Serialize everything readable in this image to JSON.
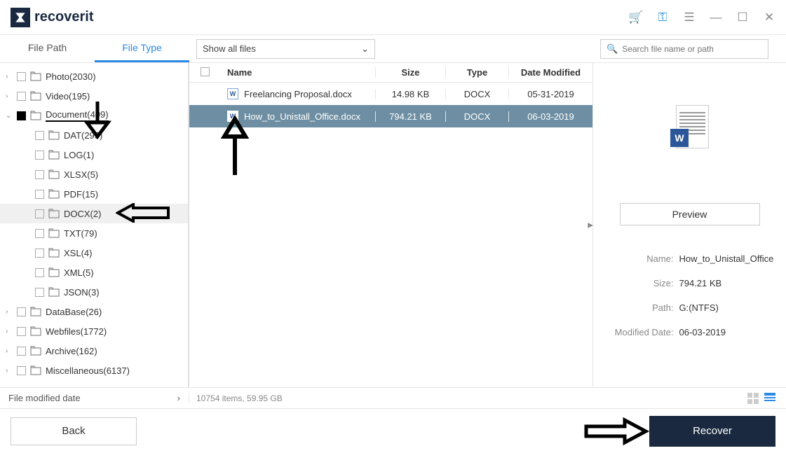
{
  "app": {
    "name": "recoverit"
  },
  "tabs": {
    "file_path": "File Path",
    "file_type": "File Type"
  },
  "filter": {
    "label": "Show all files"
  },
  "search": {
    "placeholder": "Search file name or path"
  },
  "tree": [
    {
      "label": "Photo(2030)",
      "caret": "›",
      "child": false
    },
    {
      "label": "Video(195)",
      "caret": "›",
      "child": false
    },
    {
      "label": "Document(409)",
      "caret": "⌄",
      "child": false,
      "filled": true,
      "underlined": true
    },
    {
      "label": "DAT(295)",
      "child": true
    },
    {
      "label": "LOG(1)",
      "child": true
    },
    {
      "label": "XLSX(5)",
      "child": true
    },
    {
      "label": "PDF(15)",
      "child": true
    },
    {
      "label": "DOCX(2)",
      "child": true,
      "selected": true
    },
    {
      "label": "TXT(79)",
      "child": true
    },
    {
      "label": "XSL(4)",
      "child": true
    },
    {
      "label": "XML(5)",
      "child": true
    },
    {
      "label": "JSON(3)",
      "child": true
    },
    {
      "label": "DataBase(26)",
      "caret": "›",
      "child": false
    },
    {
      "label": "Webfiles(1772)",
      "caret": "›",
      "child": false
    },
    {
      "label": "Archive(162)",
      "caret": "›",
      "child": false
    },
    {
      "label": "Miscellaneous(6137)",
      "caret": "›",
      "child": false
    }
  ],
  "table": {
    "headers": {
      "name": "Name",
      "size": "Size",
      "type": "Type",
      "date": "Date Modified"
    },
    "rows": [
      {
        "name": "Freelancing Proposal.docx",
        "size": "14.98  KB",
        "type": "DOCX",
        "date": "05-31-2019"
      },
      {
        "name": "How_to_Unistall_Office.docx",
        "size": "794.21  KB",
        "type": "DOCX",
        "date": "06-03-2019",
        "selected": true
      }
    ]
  },
  "preview": {
    "button": "Preview",
    "meta": {
      "name_label": "Name:",
      "name": "How_to_Unistall_Office.docx",
      "size_label": "Size:",
      "size": "794.21  KB",
      "path_label": "Path:",
      "path": "G:(NTFS)",
      "date_label": "Modified Date:",
      "date": "06-03-2019"
    }
  },
  "filterbar": {
    "label": "File modified date"
  },
  "status": {
    "text": "10754 items, 59.95  GB"
  },
  "buttons": {
    "back": "Back",
    "recover": "Recover"
  }
}
